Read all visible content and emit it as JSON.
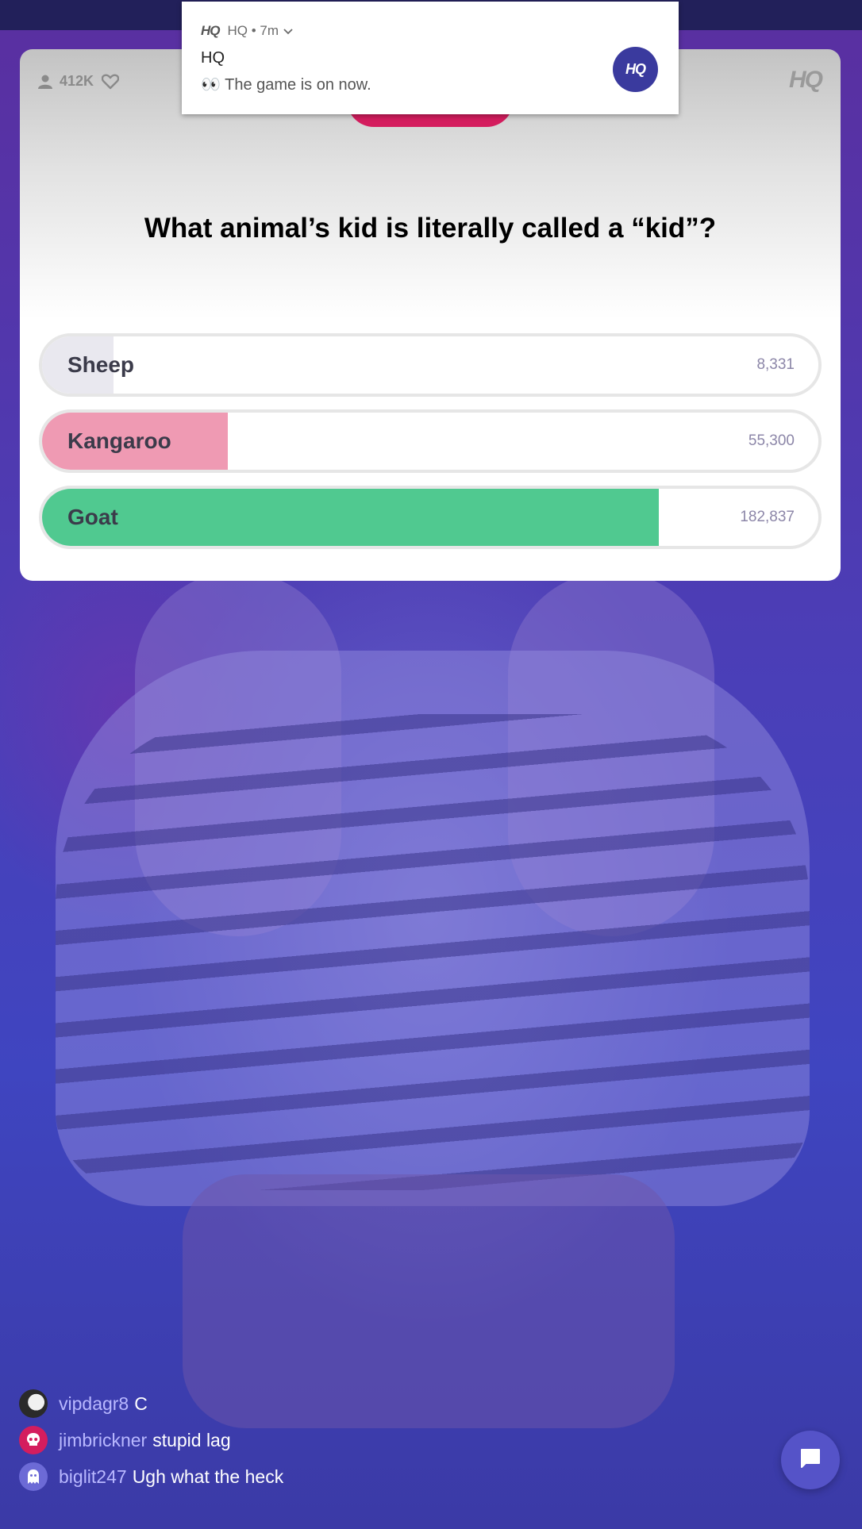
{
  "notification": {
    "app": "HQ",
    "meta": "HQ • 7m",
    "title": "HQ",
    "body": "👀 The game is on now.",
    "avatar_text": "HQ"
  },
  "card": {
    "viewer_count": "412K",
    "logo": "HQ",
    "question": "What animal’s kid is literally called a “kid”?",
    "answers": [
      {
        "label": "Sheep",
        "votes": "8,331",
        "share": 0.0337,
        "color": "#e9e8ef"
      },
      {
        "label": "Kangaroo",
        "votes": "55,300",
        "share": 0.2236,
        "color": "#ef9ab3"
      },
      {
        "label": "Goat",
        "votes": "182,837",
        "share": 0.7427,
        "color": "#50c990"
      }
    ]
  },
  "chat": {
    "messages": [
      {
        "user": "vipdagr8",
        "text": "C",
        "avatar": "photo"
      },
      {
        "user": "jimbrickner",
        "text": "stupid lag",
        "avatar": "skull"
      },
      {
        "user": "biglit247",
        "text": "Ugh what the heck",
        "avatar": "ghost"
      }
    ],
    "button_icon": "chat-bubble-icon"
  },
  "colors": {
    "accent": "#d41d5e",
    "correct": "#50c990",
    "chat_user": "#b9b8ff",
    "brand": "#3a3a9e"
  }
}
